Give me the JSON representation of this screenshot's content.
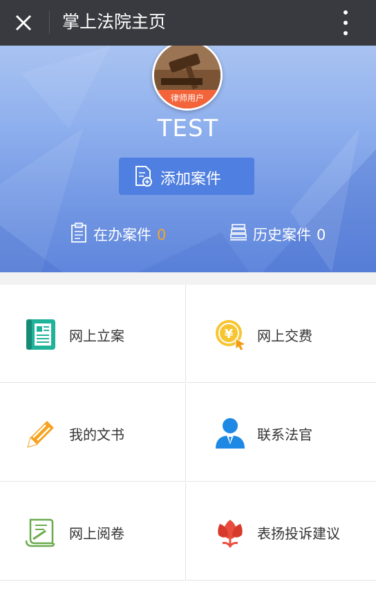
{
  "topbar": {
    "title": "掌上法院主页"
  },
  "profile": {
    "avatar_badge": "律师用户",
    "username": "TEST",
    "add_case_label": "添加案件",
    "active_cases_label": "在办案件",
    "active_cases_count": "0",
    "history_cases_label": "历史案件",
    "history_cases_count": "0"
  },
  "menu": [
    {
      "label": "网上立案",
      "icon": "filing-document-icon"
    },
    {
      "label": "网上交费",
      "icon": "yuan-coin-icon"
    },
    {
      "label": "我的文书",
      "icon": "pencil-icon"
    },
    {
      "label": "联系法官",
      "icon": "judge-person-icon"
    },
    {
      "label": "网上阅卷",
      "icon": "scroll-icon"
    },
    {
      "label": "表扬投诉建议",
      "icon": "flower-icon"
    }
  ],
  "colors": {
    "topbar": "#393a3f",
    "accent_blue": "#4f7fe0",
    "badge_orange": "#f3643b",
    "count_orange": "#f5a623"
  }
}
